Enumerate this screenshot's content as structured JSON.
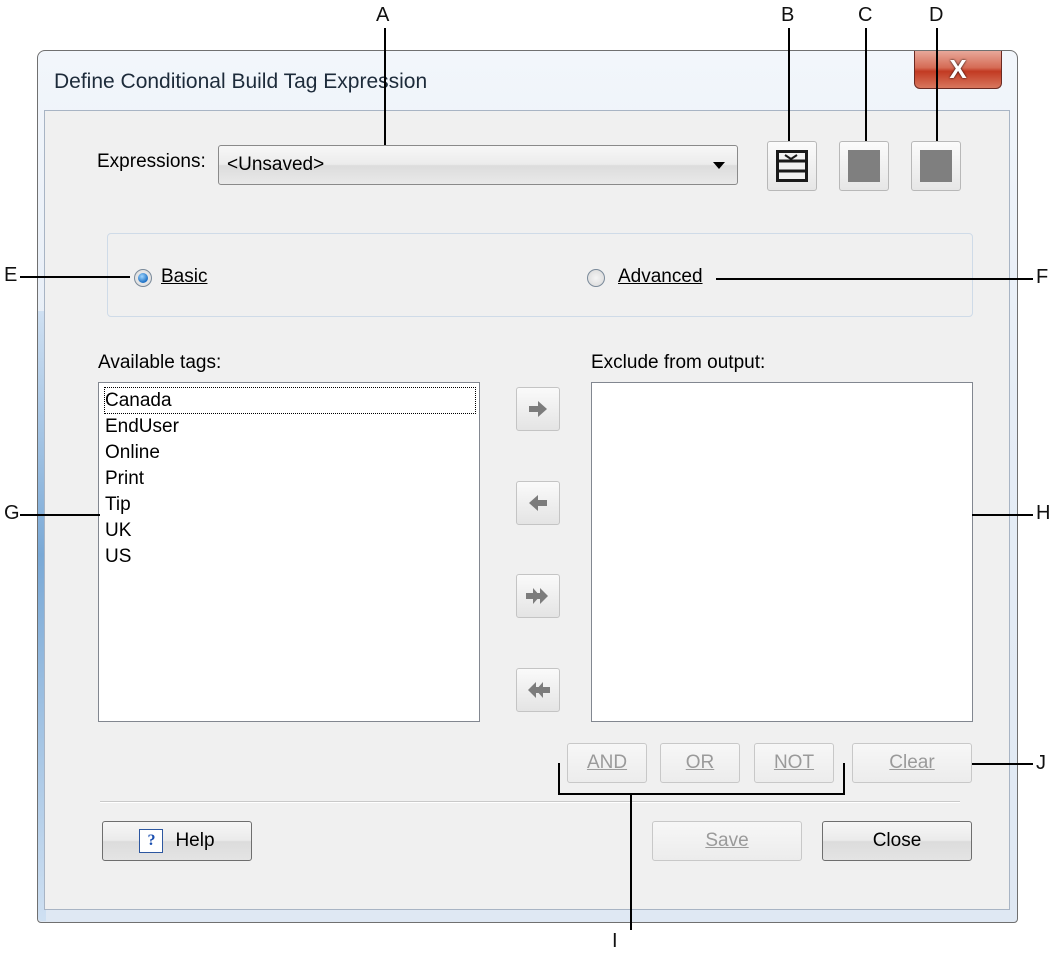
{
  "window": {
    "title": "Define Conditional Build Tag Expression",
    "close_glyph": "X"
  },
  "expressions": {
    "label": "Expressions:",
    "selected": "<Unsaved>"
  },
  "toolbar": {
    "b_icon": "expression-edit-icon",
    "c_icon": "gray-square-icon",
    "d_icon": "gray-square-icon"
  },
  "mode": {
    "basic_label": "Basic",
    "advanced_label": "Advanced",
    "selected": "Basic"
  },
  "available": {
    "label": "Available tags:",
    "items": [
      "Canada",
      "EndUser",
      "Online",
      "Print",
      "Tip",
      "UK",
      "US"
    ]
  },
  "exclude": {
    "label": "Exclude from output:",
    "items": []
  },
  "move_buttons": [
    "move-right-icon",
    "move-left-icon",
    "move-all-right-icon",
    "move-all-left-icon"
  ],
  "operators": {
    "and": "AND",
    "or": "OR",
    "not": "NOT",
    "clear": "Clear"
  },
  "footer": {
    "help": "Help",
    "save": "Save",
    "close": "Close"
  },
  "callouts": {
    "A": "A",
    "B": "B",
    "C": "C",
    "D": "D",
    "E": "E",
    "F": "F",
    "G": "G",
    "H": "H",
    "I": "I",
    "J": "J"
  }
}
